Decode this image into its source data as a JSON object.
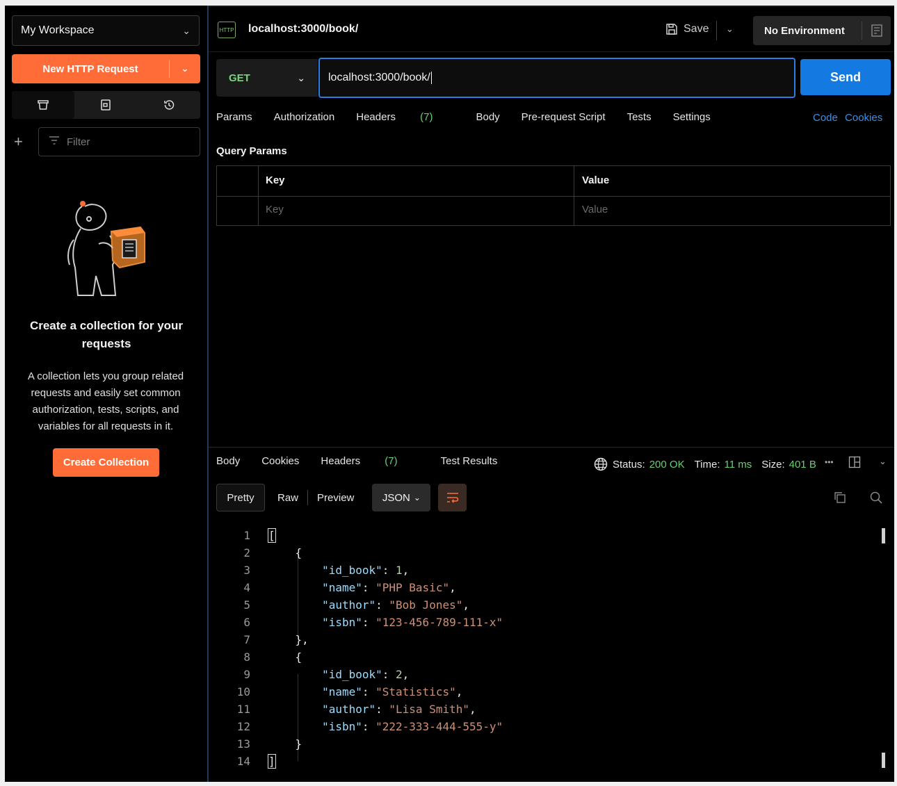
{
  "sidebar": {
    "workspace": "My Workspace",
    "new_request": "New HTTP Request",
    "filter_placeholder": "Filter",
    "empty_title": "Create a collection for your requests",
    "empty_desc": "A collection lets you group related requests and easily set common authorization, tests, scripts, and variables for all requests in it.",
    "create_button": "Create Collection",
    "tabs": [
      "collections-icon",
      "apis-icon",
      "history-icon"
    ]
  },
  "header": {
    "badge": "HTTP",
    "title": "localhost:3000/book/",
    "save": "Save",
    "environment": "No Environment"
  },
  "request": {
    "method": "GET",
    "url": "localhost:3000/book/",
    "send": "Send",
    "tabs": {
      "params": "Params",
      "authorization": "Authorization",
      "headers": "Headers",
      "headers_count": "(7)",
      "body": "Body",
      "prerequest": "Pre-request Script",
      "tests": "Tests",
      "settings": "Settings"
    },
    "code": "Code",
    "cookies": "Cookies",
    "query_params_label": "Query Params",
    "table": {
      "col_key": "Key",
      "col_value": "Value",
      "key_placeholder": "Key",
      "value_placeholder": "Value"
    }
  },
  "response": {
    "tabs": {
      "body": "Body",
      "cookies": "Cookies",
      "headers": "Headers",
      "headers_count": "(7)",
      "test_results": "Test Results"
    },
    "status_label": "Status:",
    "status_value": "200 OK",
    "time_label": "Time:",
    "time_value": "11 ms",
    "size_label": "Size:",
    "size_value": "401 B",
    "format": {
      "pretty": "Pretty",
      "raw": "Raw",
      "preview": "Preview",
      "json": "JSON"
    }
  },
  "colors": {
    "accent": "#ff6c37",
    "send": "#1479e0",
    "method_get": "#77d67e",
    "status_ok": "#6bcf73",
    "link": "#3d8fe6"
  },
  "code_lines": {
    "n1": "1",
    "n2": "2",
    "n3": "3",
    "n4": "4",
    "n5": "5",
    "n6": "6",
    "n7": "7",
    "n8": "8",
    "n9": "9",
    "n10": "10",
    "n11": "11",
    "n12": "12",
    "n13": "13",
    "n14": "14",
    "k_id": "\"id_book\"",
    "k_name": "\"name\"",
    "k_author": "\"author\"",
    "k_isbn": "\"isbn\"",
    "v1_id": "1",
    "v1_name": "\"PHP Basic\"",
    "v1_author": "\"Bob Jones\"",
    "v1_isbn": "\"123-456-789-111-x\"",
    "v2_id": "2",
    "v2_name": "\"Statistics\"",
    "v2_author": "\"Lisa Smith\"",
    "v2_isbn": "\"222-333-444-555-y\""
  }
}
